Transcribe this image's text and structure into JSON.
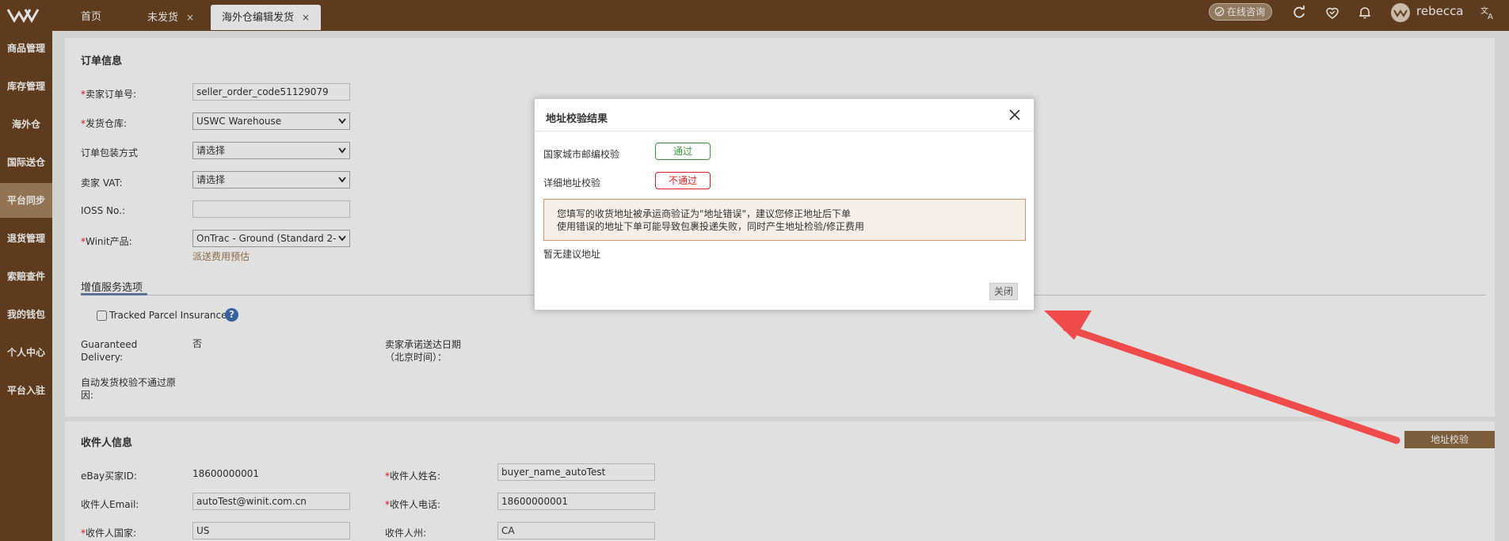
{
  "topbar": {
    "tabs": [
      {
        "label": "首页",
        "closable": false,
        "active": false
      },
      {
        "label": "未发货",
        "closable": true,
        "active": false
      },
      {
        "label": "海外仓编辑发货",
        "closable": true,
        "active": true
      }
    ],
    "online_consult": "在线咨询",
    "username": "rebecca",
    "close_glyph": "×"
  },
  "sidebar": {
    "items": [
      {
        "label": "商品管理",
        "active": false
      },
      {
        "label": "库存管理",
        "active": false
      },
      {
        "label": "海外仓",
        "active": false
      },
      {
        "label": "国际送仓",
        "active": false
      },
      {
        "label": "平台同步",
        "active": true
      },
      {
        "label": "退货管理",
        "active": false
      },
      {
        "label": "索赔查件",
        "active": false
      },
      {
        "label": "我的钱包",
        "active": false
      },
      {
        "label": "个人中心",
        "active": false
      },
      {
        "label": "平台入驻",
        "active": false
      }
    ]
  },
  "order": {
    "section_title": "订单信息",
    "seller_order_no_label": "卖家订单号:",
    "seller_order_no_value": "seller_order_code51129079",
    "warehouse_label": "发货仓库:",
    "warehouse_value": "USWC Warehouse",
    "packing_label": "订单包装方式",
    "packing_value": "请选择",
    "vat_label": "卖家 VAT:",
    "vat_value": "请选择",
    "ioss_label": "IOSS No.:",
    "ioss_value": "",
    "product_label": "Winit产品:",
    "product_value": "OnTrac - Ground (Standard 2-",
    "fee_estimate_link": "派送费用预估",
    "required_mark": "*"
  },
  "value_added": {
    "tab_label": "增值服务选项",
    "insurance_label": "Tracked Parcel Insurance",
    "help_glyph": "?",
    "guaranteed_label": "Guaranteed\nDelivery:",
    "guaranteed_value": "否",
    "promise_date_label": "卖家承诺送达日期\n（北京时间）：",
    "auto_fail_reason_label": "自动发货校验不通过原\n因:"
  },
  "recipient": {
    "section_title": "收件人信息",
    "ebay_buyer_id_label": "eBay买家ID:",
    "ebay_buyer_id_value": "18600000001",
    "name_label": "收件人姓名:",
    "name_value": "buyer_name_autoTest",
    "email_label": "收件人Email:",
    "email_value": "autoTest@winit.com.cn",
    "phone_label": "收件人电话:",
    "phone_value": "18600000001",
    "country_label": "收件人国家:",
    "country_value": "US",
    "state_label": "收件人州:",
    "state_value": "CA",
    "address_check_button": "地址校验"
  },
  "modal": {
    "title": "地址校验结果",
    "country_city_zip_label": "国家城市邮编校验",
    "country_city_zip_result": "通过",
    "detail_address_label": "详细地址校验",
    "detail_address_result": "不通过",
    "warning_line1": "您填写的收货地址被承运商验证为\"地址错误\"，建议您修正地址后下单",
    "warning_line2": "使用错误的地址下单可能导致包裹投递失败，同时产生地址检验/修正费用",
    "no_suggestion": "暂无建议地址",
    "close_button": "关闭"
  },
  "colors": {
    "brand_brown": "#6b4420",
    "active_sidebar": "#a8855e",
    "pass_green": "#3a9a3a",
    "fail_red": "#e02020",
    "annotation_arrow": "#ef4b4b"
  }
}
